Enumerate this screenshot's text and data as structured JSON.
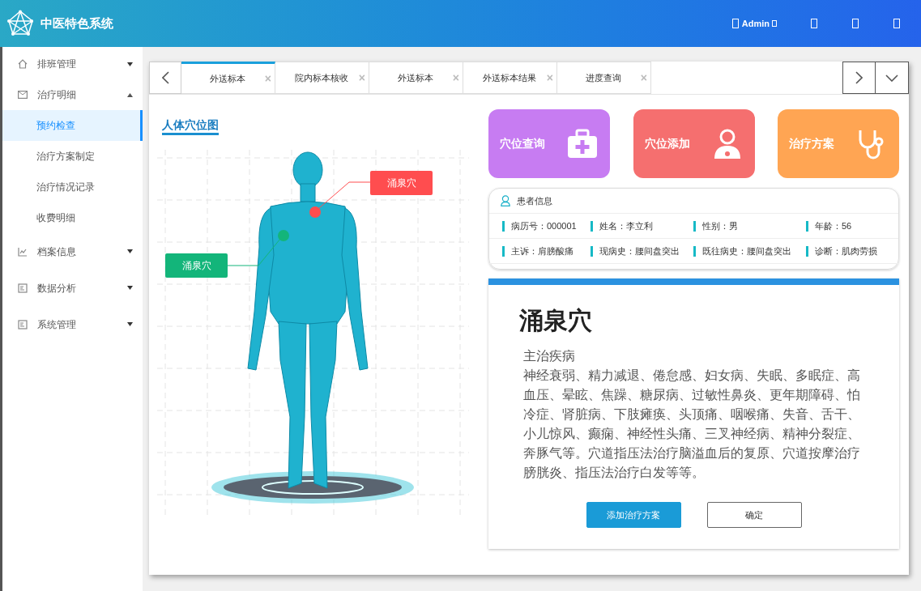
{
  "header": {
    "title": "中医特色系统",
    "user": "Admin"
  },
  "sidebar": {
    "items": [
      {
        "label": "排班管理",
        "expanded": false
      },
      {
        "label": "治疗明细",
        "expanded": true,
        "children": [
          {
            "label": "预约检查",
            "selected": true
          },
          {
            "label": "治疗方案制定",
            "selected": false
          },
          {
            "label": "治疗情况记录",
            "selected": false
          },
          {
            "label": "收费明细",
            "selected": false
          }
        ]
      },
      {
        "label": "档案信息",
        "expanded": false
      },
      {
        "label": "数据分析",
        "expanded": false
      },
      {
        "label": "系统管理",
        "expanded": false
      }
    ]
  },
  "tabs": [
    {
      "label": "外送标本",
      "close": "×",
      "selected": true
    },
    {
      "label": "院内标本核收",
      "close": "×",
      "selected": false
    },
    {
      "label": "外送标本",
      "close": "×",
      "selected": false
    },
    {
      "label": "外送标本结果",
      "close": "×",
      "selected": false
    },
    {
      "label": "进度查询",
      "close": "×",
      "selected": false
    }
  ],
  "body_map": {
    "title": "人体穴位图",
    "markers": [
      {
        "label": "涌泉穴",
        "color": "#ff4d4f"
      },
      {
        "label": "涌泉穴",
        "color": "#13b57a"
      }
    ]
  },
  "action_cards": [
    {
      "label": "穴位查询",
      "kind": "medkit",
      "color": "#c77cf2"
    },
    {
      "label": "穴位添加",
      "kind": "doctor",
      "color": "#f56f6f"
    },
    {
      "label": "治疗方案",
      "kind": "stethoscope",
      "color": "#ffa553"
    }
  ],
  "patient": {
    "title": "患者信息",
    "rows": [
      [
        "病历号：000001",
        "姓名：李立利",
        "性别：男",
        "年龄：56"
      ],
      [
        "主诉：肩膀酸痛",
        "现病史：腰间盘突出",
        "既往病史：腰间盘突出",
        "诊断：肌肉劳损"
      ]
    ]
  },
  "detail": {
    "title": "涌泉穴",
    "section": "主治疾病",
    "text": "神经衰弱、精力减退、倦怠感、妇女病、失眠、多眠症、高血压、晕眩、焦躁、糖尿病、过敏性鼻炎、更年期障碍、怕冷症、肾脏病、下肢瘫痪、头顶痛、咽喉痛、失音、舌干、小儿惊风、癫痫、神经性头痛、三叉神经病、精神分裂症、奔豚气等。穴道指压法治疗脑溢血后的复原、穴道按摩治疗膀胱炎、指压法治疗白发等等。",
    "buttons": [
      {
        "label": "添加治疗方案",
        "kind": "primary"
      },
      {
        "label": "确定",
        "kind": "secondary"
      }
    ]
  }
}
